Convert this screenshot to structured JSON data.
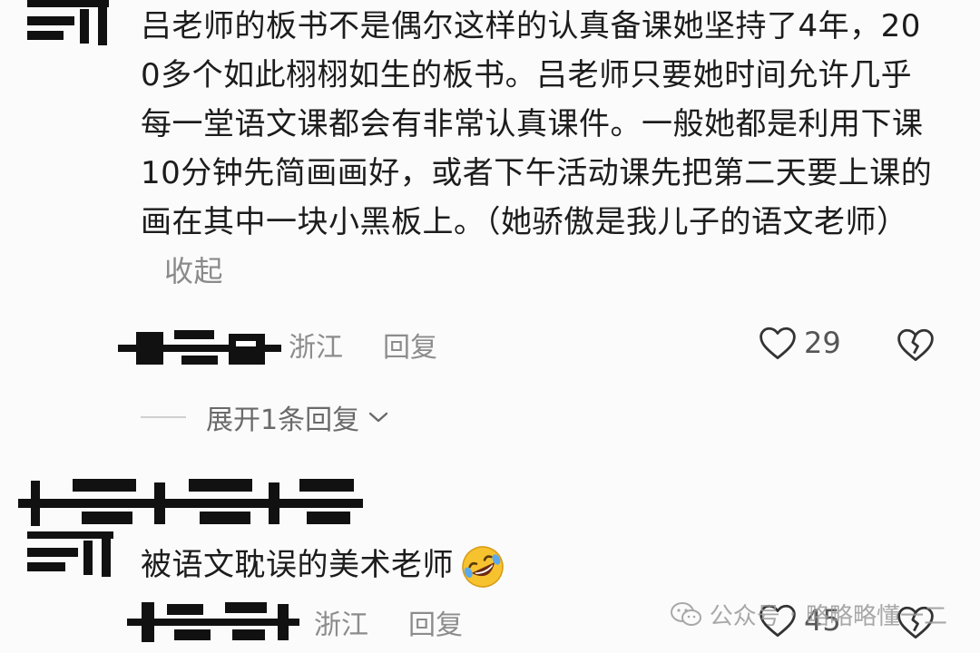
{
  "comments": [
    {
      "text": "吕老师的板书不是偶尔这样的认真备课她坚持了4年，200多个如此栩栩如生的板书。吕老师只要她时间允许几乎每一堂语文课都会有非常认真课件。一般她都是利用下课10分钟先简画画好，或者下午活动课先把第二天要上课的画在其中一块小黑板上。（她骄傲是我儿子的语文老师）",
      "collapse_label": "收起",
      "location": "浙江",
      "reply_label": "回复",
      "likes": "29",
      "expand_label": "展开1条回复"
    },
    {
      "text": "被语文耽误的美术老师",
      "emoji": "rofl-emoji",
      "location": "浙江",
      "reply_label": "回复",
      "likes": "45"
    }
  ],
  "icons": {
    "heart": "heart-outline-icon",
    "broken_heart": "broken-heart-icon",
    "chevron": "chevron-down-icon",
    "wechat": "wechat-icon"
  },
  "watermark": {
    "prefix": "公众号",
    "name": "略略略懂一二"
  },
  "colors": {
    "text": "#1c1c1c",
    "meta": "#8c8c8c",
    "emoji_face": "#f6c22e"
  }
}
